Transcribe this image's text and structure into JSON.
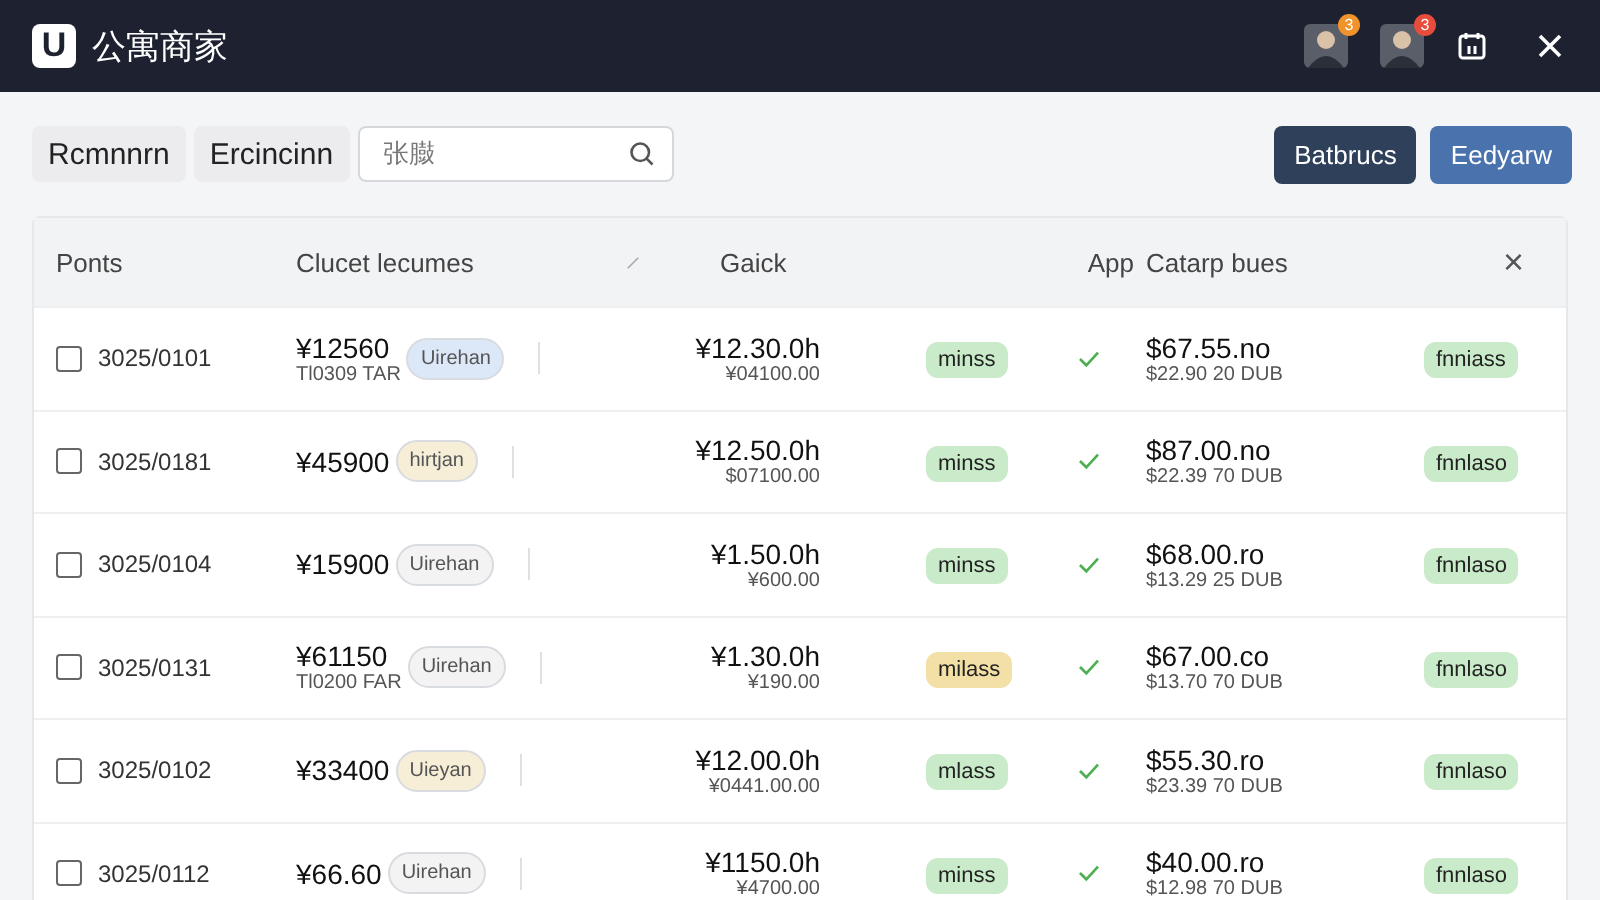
{
  "app_bar": {
    "logo": "U",
    "title": "公寓商家",
    "avatars": [
      {
        "badge": "3",
        "color": "#f0932b"
      },
      {
        "badge": "3",
        "color": "#e74c3c"
      }
    ]
  },
  "toolbar": {
    "filters": [
      "Rcmnnrn",
      "Ercincinn"
    ],
    "search": {
      "placeholder": "张臌"
    },
    "buttons": [
      {
        "label": "Batbrucs",
        "kind": "dark"
      },
      {
        "label": "Eedyarw",
        "kind": "primary"
      }
    ]
  },
  "table": {
    "columns": [
      "Ponts",
      "Clucet lecumes",
      "Gaick",
      "App",
      "Catarp bues"
    ],
    "close": "×",
    "rows": [
      {
        "checked": false,
        "date": "3025/0101",
        "amount": "¥12560",
        "amount_sub": "Tl0309 TAR",
        "tag": {
          "label": "Uirehan",
          "color": "#dce8f7"
        },
        "price": "¥12.30.0h",
        "price_sub": "¥04100.00",
        "status": {
          "label": "minss",
          "color": "#c9ebc9"
        },
        "approved": true,
        "catalog": "$67.55.no",
        "catalog_sub": "$22.90 20 DUB",
        "result": "fnniass"
      },
      {
        "checked": false,
        "date": "3025/0181",
        "amount": "¥45900",
        "tag": {
          "label": "hirtjan",
          "color": "#f7eed8"
        },
        "price": "¥12.50.0h",
        "price_sub": "$07100.00",
        "status": {
          "label": "minss",
          "color": "#c9ebc9"
        },
        "approved": true,
        "catalog": "$87.00.no",
        "catalog_sub": "$22.39 70 DUB",
        "result": "fnnlaso"
      },
      {
        "checked": false,
        "date": "3025/0104",
        "amount": "¥15900",
        "tag": {
          "label": "Uirehan",
          "color": "#f3f3f3"
        },
        "price": "¥1.50.0h",
        "price_sub": "¥600.00",
        "status": {
          "label": "minss",
          "color": "#c9ebc9"
        },
        "approved": true,
        "catalog": "$68.00.ro",
        "catalog_sub": "$13.29 25 DUB",
        "result": "fnnlaso"
      },
      {
        "checked": false,
        "date": "3025/0131",
        "amount": "¥61150",
        "amount_sub": "Tl0200 FAR",
        "tag": {
          "label": "Uirehan",
          "color": "#f3f3f3"
        },
        "price": "¥1.30.0h",
        "price_sub": "¥190.00",
        "status": {
          "label": "milass",
          "color": "#f3e0a6"
        },
        "approved": true,
        "catalog": "$67.00.co",
        "catalog_sub": "$13.70 70 DUB",
        "result": "fnnlaso"
      },
      {
        "checked": false,
        "date": "3025/0102",
        "amount": "¥33400",
        "tag": {
          "label": "Uieyan",
          "color": "#f7eed8"
        },
        "price": "¥12.00.0h",
        "price_sub": "¥0441.00.00",
        "status": {
          "label": "mlass",
          "color": "#c9ebc9"
        },
        "approved": true,
        "catalog": "$55.30.ro",
        "catalog_sub": "$23.39 70 DUB",
        "result": "fnnlaso"
      },
      {
        "checked": false,
        "date": "3025/0112",
        "amount": "¥66.60",
        "tag": {
          "label": "Uirehan",
          "color": "#f3f3f3"
        },
        "price": "¥1150.0h",
        "price_sub": "¥4700.00",
        "status": {
          "label": "minss",
          "color": "#c9ebc9"
        },
        "approved": true,
        "catalog": "$40.00.ro",
        "catalog_sub": "$12.98 70 DUB",
        "result": "fnnlaso"
      }
    ]
  }
}
